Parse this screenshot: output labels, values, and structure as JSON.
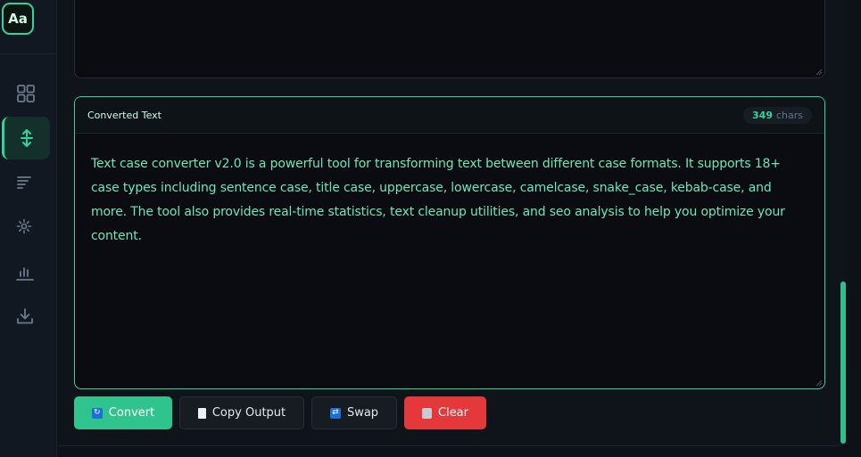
{
  "app": {
    "logo_text": "Aa",
    "accent_color": "#34d399"
  },
  "sidebar": {
    "items": [
      {
        "icon": "grid-icon",
        "active": false
      },
      {
        "icon": "expand-vertical-icon",
        "active": true
      },
      {
        "icon": "lines-icon",
        "active": false
      },
      {
        "icon": "sparkle-icon",
        "active": false
      },
      {
        "icon": "bar-chart-icon",
        "active": false
      },
      {
        "icon": "download-icon",
        "active": false
      }
    ]
  },
  "output": {
    "title": "Converted Text",
    "char_count": "349",
    "char_unit": "chars",
    "text": "Text case converter v2.0 is a powerful tool for transforming text between different case formats. It supports 18+ case types including sentence case, title case, uppercase, lowercase, camelcase, snake_case, kebab-case, and more. The tool also provides real-time statistics, text cleanup utilities, and seo analysis to help you optimize your content."
  },
  "actions": {
    "convert_label": "Convert",
    "copy_label": "Copy Output",
    "swap_label": "Swap",
    "clear_label": "Clear",
    "convert_color": "#2fc48d",
    "clear_color": "#e5383b"
  }
}
